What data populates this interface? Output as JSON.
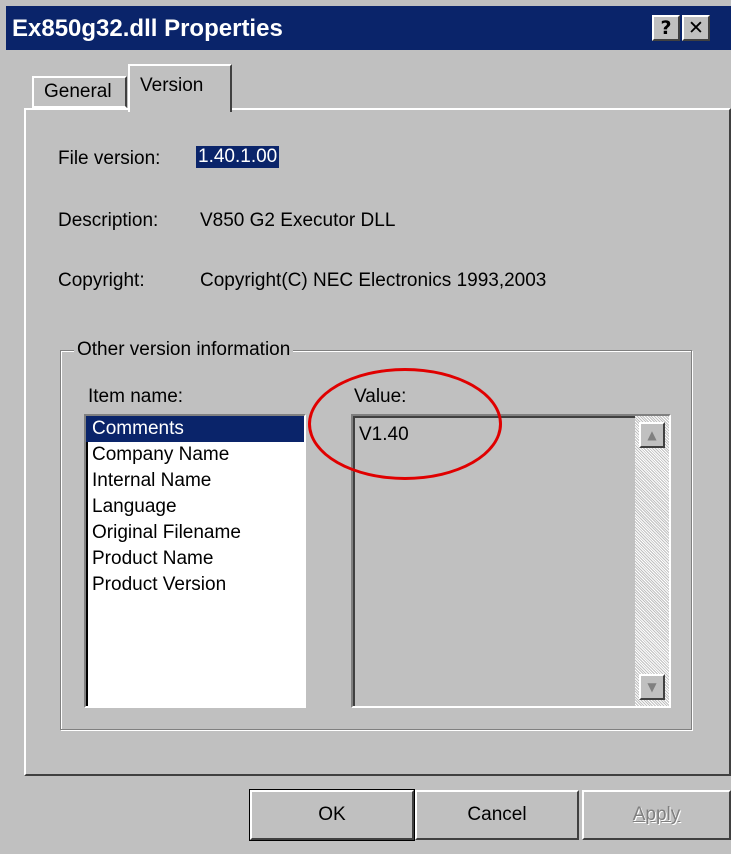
{
  "window": {
    "title": "Ex850g32.dll Properties",
    "help_button": "?",
    "close_button": "✕"
  },
  "tabs": [
    {
      "label": "General",
      "active": false
    },
    {
      "label": "Version",
      "active": true
    }
  ],
  "fields": {
    "file_version_label": "File version:",
    "file_version_value": "1.40.1.00",
    "description_label": "Description:",
    "description_value": "V850 G2 Executor DLL",
    "copyright_label": "Copyright:",
    "copyright_value": "Copyright(C) NEC Electronics 1993,2003"
  },
  "other_info": {
    "group_title": "Other version information",
    "item_name_label": "Item name:",
    "value_label": "Value:",
    "items": [
      "Comments",
      "Company Name",
      "Internal Name",
      "Language",
      "Original Filename",
      "Product Name",
      "Product Version"
    ],
    "selected_index": 0,
    "value": "V1.40"
  },
  "buttons": {
    "ok": "OK",
    "cancel": "Cancel",
    "apply": "Apply"
  },
  "colors": {
    "titlebar": "#0a246a",
    "dialog_bg": "#c0c0c0",
    "selection": "#0a246a",
    "annotation_circle": "#e00000"
  }
}
